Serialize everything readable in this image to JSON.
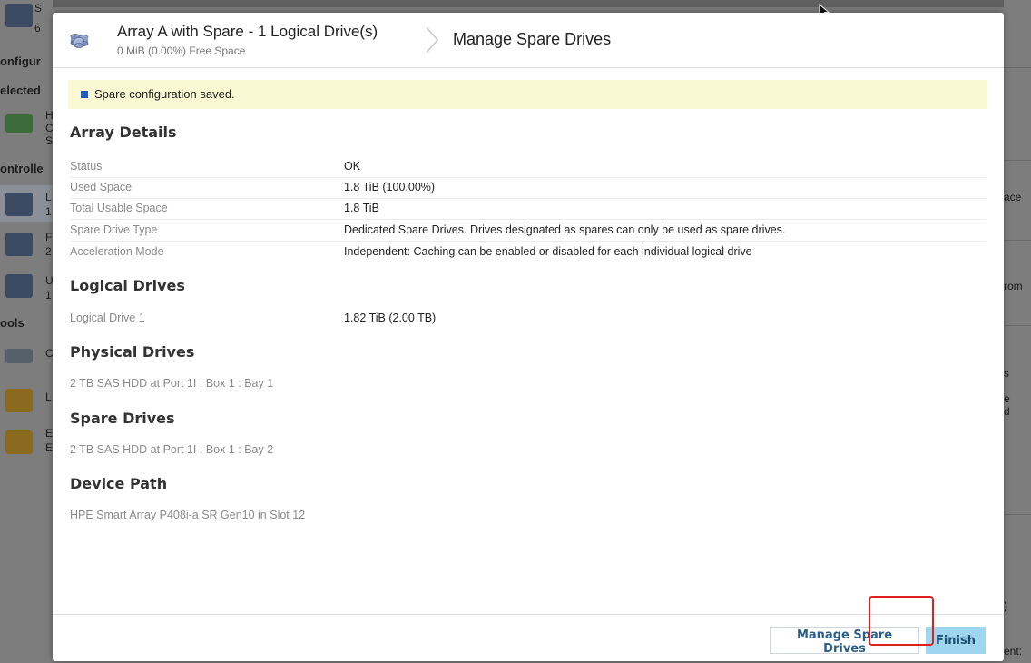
{
  "background": {
    "left_fragments": [
      "S",
      "6",
      "onfigur",
      "elected",
      "H",
      "C",
      "S",
      "ontrolle",
      "L",
      "1",
      "F",
      "2",
      "U",
      "1",
      "ools",
      "C",
      "L",
      "E",
      "E"
    ],
    "right_fragments": [
      "ace",
      "rom",
      "s",
      "e",
      "d",
      ")",
      "ent:"
    ]
  },
  "modal": {
    "header": {
      "title": "Array A with Spare - 1 Logical Drive(s)",
      "subtitle": "0 MiB (0.00%) Free Space",
      "page_title": "Manage Spare Drives",
      "icon": "array-icon"
    },
    "notice": {
      "text": "Spare configuration saved.",
      "color": "#1f5bb8"
    },
    "array_details": {
      "title": "Array Details",
      "rows": [
        {
          "key": "Status",
          "value": "OK"
        },
        {
          "key": "Used Space",
          "value": "1.8 TiB (100.00%)"
        },
        {
          "key": "Total Usable Space",
          "value": "1.8 TiB"
        },
        {
          "key": "Spare Drive Type",
          "value": "Dedicated Spare Drives. Drives designated as spares can only be used as spare drives."
        },
        {
          "key": "Acceleration Mode",
          "value": "Independent: Caching can be enabled or disabled for each individual logical drive"
        }
      ]
    },
    "logical_drives": {
      "title": "Logical Drives",
      "items": [
        {
          "name": "Logical Drive 1",
          "size": "1.82 TiB (2.00 TB)"
        }
      ]
    },
    "physical_drives": {
      "title": "Physical Drives",
      "items": [
        "2 TB SAS HDD at Port 1I : Box 1 : Bay 1"
      ]
    },
    "spare_drives": {
      "title": "Spare Drives",
      "items": [
        "2 TB SAS HDD at Port 1I : Box 1 : Bay 2"
      ]
    },
    "device_path": {
      "title": "Device Path",
      "value": "HPE Smart Array P408i-a SR Gen10 in Slot 12"
    },
    "footer": {
      "secondary_label": "Manage Spare Drives",
      "primary_label": "Finish"
    }
  },
  "colors": {
    "accent": "#9ed6ef",
    "highlight": "#e01f1f",
    "notice_bg": "#fbf8d4"
  }
}
